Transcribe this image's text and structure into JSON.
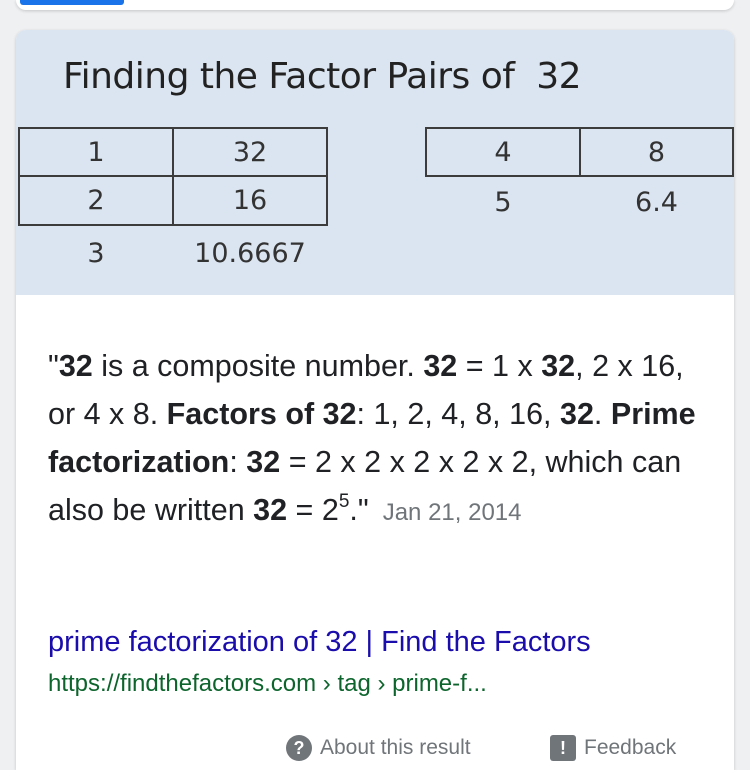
{
  "figure": {
    "title": "Finding the Factor Pairs of  32",
    "table_left": [
      [
        "1",
        "32"
      ],
      [
        "2",
        "16"
      ],
      [
        "3",
        "10.6667"
      ]
    ],
    "table_right": [
      [
        "4",
        "8"
      ],
      [
        "5",
        "6.4"
      ]
    ]
  },
  "snippet": {
    "open_quote": "\"",
    "num": "32",
    "t1": " is a composite number. ",
    "t2": " = 1 x ",
    "t3": ", 2 x 16, or 4 x 8. ",
    "factors_label": "Factors of 32",
    "t4": ": 1, 2, 4, 8, 16, ",
    "t5": ". ",
    "prime_label": "Prime factorization",
    "t6": ": ",
    "t7": " = 2 x 2 x 2 x 2 x 2, which can also be written ",
    "t8": " = 2",
    "exponent": "5",
    "t9": ".\"",
    "date": "Jan 21, 2014"
  },
  "result": {
    "title": "prime factorization of 32 | Find the Factors",
    "url": "https://findthefactors.com › tag › prime-f..."
  },
  "footer": {
    "about_label": "About this result",
    "about_icon": "question-icon",
    "feedback_label": "Feedback",
    "feedback_icon": "feedback-icon"
  },
  "colors": {
    "link": "#1a0dab",
    "url": "#0d652d",
    "accent": "#1a73e8",
    "figure_bg": "#dbe5f1",
    "muted": "#70757a"
  }
}
